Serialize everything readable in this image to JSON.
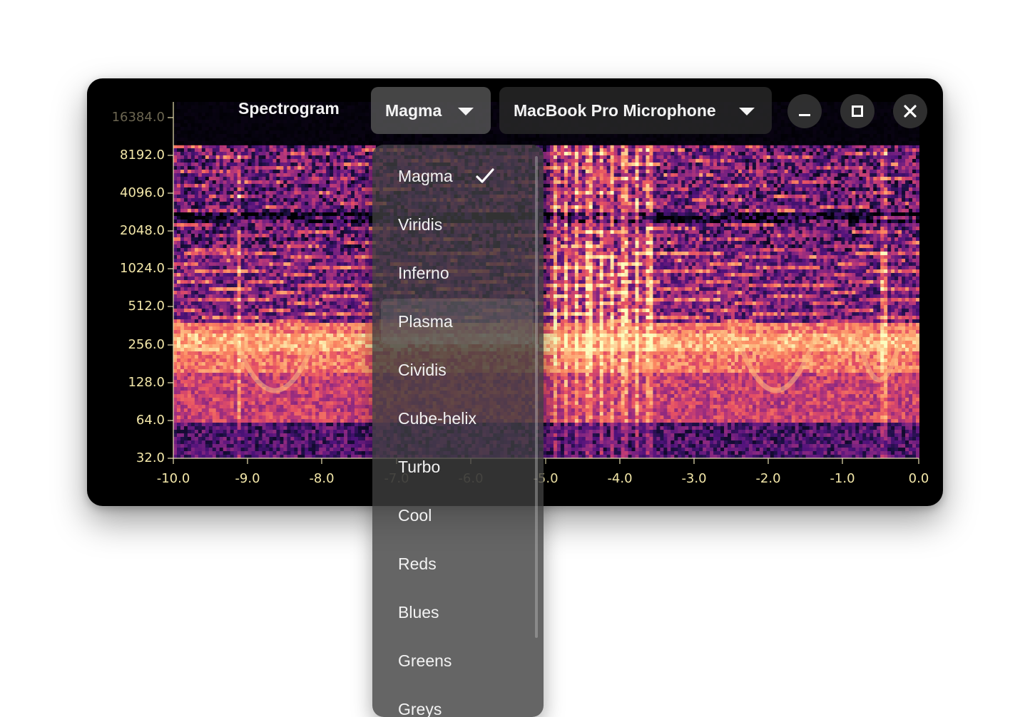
{
  "header": {
    "title": "Spectrogram",
    "colormap_selected": "Magma",
    "device_selected": "MacBook Pro Microphone"
  },
  "window_controls": {
    "minimize_icon": "minimize-icon",
    "maximize_icon": "maximize-icon",
    "close_icon": "close-icon"
  },
  "colormap_menu": {
    "items": [
      {
        "label": "Magma",
        "checked": true
      },
      {
        "label": "Viridis",
        "checked": false
      },
      {
        "label": "Inferno",
        "checked": false
      },
      {
        "label": "Plasma",
        "checked": false
      },
      {
        "label": "Cividis",
        "checked": false
      },
      {
        "label": "Cube-helix",
        "checked": false
      },
      {
        "label": "Turbo",
        "checked": false
      },
      {
        "label": "Cool",
        "checked": false
      },
      {
        "label": "Reds",
        "checked": false
      },
      {
        "label": "Blues",
        "checked": false
      },
      {
        "label": "Greens",
        "checked": false
      },
      {
        "label": "Greys",
        "checked": false
      }
    ]
  },
  "chart_data": {
    "type": "heatmap",
    "y_scale": "log2",
    "y_ticks": [
      "16384.0",
      "8192.0",
      "4096.0",
      "2048.0",
      "1024.0",
      "512.0",
      "256.0",
      "128.0",
      "64.0",
      "32.0"
    ],
    "x_ticks": [
      "-10.0",
      "-9.0",
      "-8.0",
      "-7.0",
      "-6.0",
      "-5.0",
      "-4.0",
      "-3.0",
      "-2.0",
      "-1.0",
      "0.0"
    ],
    "xlim": [
      -10.0,
      0.0
    ],
    "ylim": [
      32.0,
      16384.0
    ],
    "colormap": "magma",
    "colors": {
      "axis": "#e8e0b0",
      "tick_label": "#f2e6a8"
    }
  }
}
